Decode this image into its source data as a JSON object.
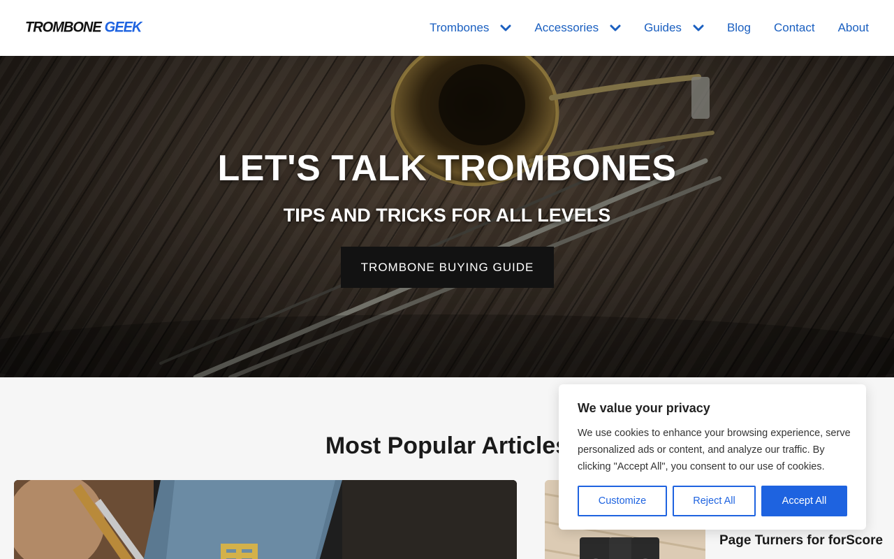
{
  "brand": {
    "word1": "TROMBONE",
    "word2": "GEEK"
  },
  "nav": [
    {
      "label": "Trombones",
      "dropdown": true
    },
    {
      "label": "Accessories",
      "dropdown": true
    },
    {
      "label": "Guides",
      "dropdown": true
    },
    {
      "label": "Blog",
      "dropdown": false
    },
    {
      "label": "Contact",
      "dropdown": false
    },
    {
      "label": "About",
      "dropdown": false
    }
  ],
  "hero": {
    "title": "LET'S TALK TROMBONES",
    "subtitle": "TIPS AND TRICKS FOR ALL LEVELS",
    "cta": "TROMBONE BUYING GUIDE"
  },
  "popular": {
    "title": "Most Popular Articles",
    "side_article_title": "Page Turners for forScore"
  },
  "cookie": {
    "title": "We value your privacy",
    "text": "We use cookies to enhance your browsing experience, serve personalized ads or content, and analyze our traffic. By clicking \"Accept All\", you consent to our use of cookies.",
    "customize": "Customize",
    "reject": "Reject All",
    "accept": "Accept All"
  },
  "colors": {
    "link": "#1a5fc0",
    "accent": "#1e63e0",
    "button_dark": "#121212"
  }
}
